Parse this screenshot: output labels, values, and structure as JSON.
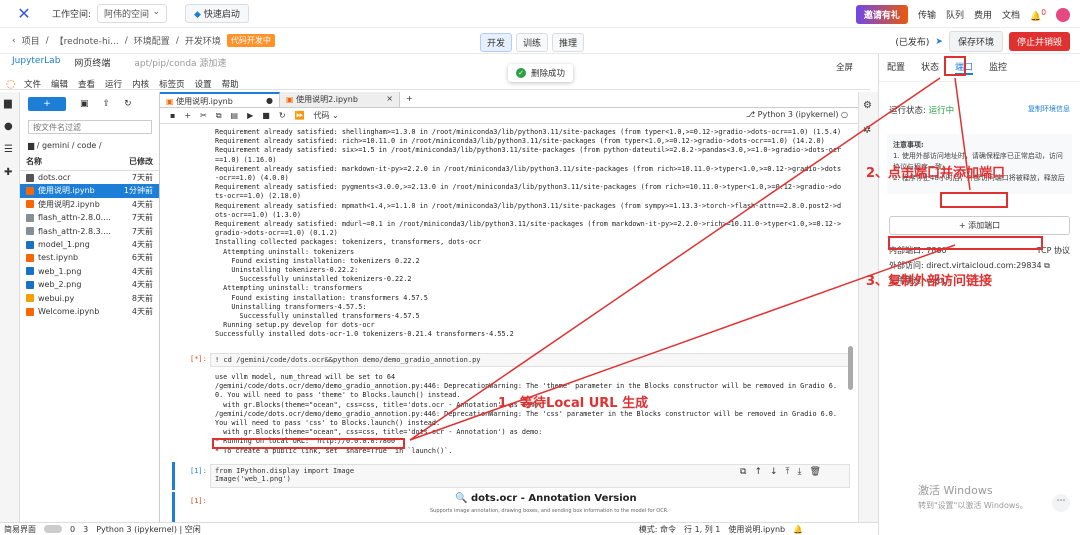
{
  "topbar": {
    "workspace_label": "工作空间:",
    "workspace_value": "阿伟的空间",
    "quick_start": "快速启动",
    "invite": "邀请有礼",
    "links": [
      "传输",
      "队列",
      "费用",
      "文档"
    ],
    "notify_count": "0"
  },
  "secbar": {
    "crumbs": [
      "项目",
      "【rednote-hi...",
      "环境配置",
      "开发环境"
    ],
    "env_tag": "代码开发中",
    "modes": [
      "开发",
      "训练",
      "推理"
    ],
    "published": "(已发布)",
    "save_env": "保存环境",
    "stop_destroy": "停止并销毁"
  },
  "jupyter": {
    "tabs": [
      "JupyterLab",
      "网页终端"
    ],
    "path_hint": "apt/pip/conda 源加速",
    "fullscreen": "全屏",
    "menus": [
      "文件",
      "编辑",
      "查看",
      "运行",
      "内核",
      "标签页",
      "设置",
      "帮助"
    ],
    "filter_placeholder": "按文件名过滤",
    "cwd": "/ gemini / code /",
    "col_name": "名称",
    "col_modified": "已修改",
    "files": [
      {
        "name": "dots.ocr",
        "mod": "7天前",
        "type": "folder"
      },
      {
        "name": "使用说明.ipynb",
        "mod": "1分钟前",
        "type": "nb",
        "selected": true
      },
      {
        "name": "使用说明2.ipynb",
        "mod": "4天前",
        "type": "nb"
      },
      {
        "name": "flash_attn-2.8.0....",
        "mod": "7天前",
        "type": "file"
      },
      {
        "name": "flash_attn-2.8.3....",
        "mod": "7天前",
        "type": "file"
      },
      {
        "name": "model_1.png",
        "mod": "4天前",
        "type": "img"
      },
      {
        "name": "test.ipynb",
        "mod": "6天前",
        "type": "nb"
      },
      {
        "name": "web_1.png",
        "mod": "4天前",
        "type": "img"
      },
      {
        "name": "web_2.png",
        "mod": "4天前",
        "type": "img"
      },
      {
        "name": "webui.py",
        "mod": "8天前",
        "type": "py"
      },
      {
        "name": "Welcome.ipynb",
        "mod": "4天前",
        "type": "nb"
      }
    ],
    "nb_tabs": [
      "使用说明.ipynb",
      "使用说明2.ipynb"
    ],
    "toolbar_cell_type": "代码",
    "kernel": "Python 3 (ipykernel)",
    "output_lines": [
      "Requirement already satisfied: shellingham>=1.3.0 in /root/miniconda3/lib/python3.11/site-packages (from typer<1.0,>=0.12->gradio->dots-ocr==1.0) (1.5.4)",
      "Requirement already satisfied: rich>=10.11.0 in /root/miniconda3/lib/python3.11/site-packages (from typer<1.0,>=0.12->gradio->dots-ocr==1.0) (14.2.0)",
      "Requirement already satisfied: six>=1.5 in /root/miniconda3/lib/python3.11/site-packages (from python-dateutil>=2.8.2->pandas<3.0,>=1.0->gradio->dots-ocr",
      "==1.0) (1.16.0)",
      "Requirement already satisfied: markdown-it-py>=2.2.0 in /root/miniconda3/lib/python3.11/site-packages (from rich>=10.11.0->typer<1.0,>=0.12->gradio->dots",
      "-ocr==1.0) (4.0.0)",
      "Requirement already satisfied: pygments<3.0.0,>=2.13.0 in /root/miniconda3/lib/python3.11/site-packages (from rich>=10.11.0->typer<1.0,>=0.12->gradio->do",
      "ts-ocr==1.0) (2.18.0)",
      "Requirement already satisfied: mpmath<1.4,>=1.1.0 in /root/miniconda3/lib/python3.11/site-packages (from sympy>=1.13.3->torch->flash-attn==2.8.0.post2->d",
      "ots-ocr==1.0) (1.3.0)",
      "Requirement already satisfied: mdurl~=0.1 in /root/miniconda3/lib/python3.11/site-packages (from markdown-it-py>=2.2.0->rich>=10.11.0->typer<1.0,>=0.12->",
      "gradio->dots-ocr==1.0) (0.1.2)",
      "Installing collected packages: tokenizers, transformers, dots-ocr",
      "  Attempting uninstall: tokenizers",
      "    Found existing installation: tokenizers 0.22.2",
      "    Uninstalling tokenizers-0.22.2:",
      "      Successfully uninstalled tokenizers-0.22.2",
      "  Attempting uninstall: transformers",
      "    Found existing installation: transformers 4.57.5",
      "    Uninstalling transformers-4.57.5:",
      "      Successfully uninstalled transformers-4.57.5",
      "  Running setup.py develop for dots-ocr",
      "Successfully installed dots-ocr-1.0 tokenizers-0.21.4 transformers-4.55.2"
    ],
    "cell2_prompt": "[*]:",
    "cell2_code": "! cd /gemini/code/dots.ocr&&python demo/demo_gradio_annotion.py",
    "cell2_output": [
      "use vllm model, num_thread will be set to 64",
      "/gemini/code/dots.ocr/demo/demo_gradio_annotion.py:446: DeprecationWarning: The 'theme' parameter in the Blocks constructor will be removed in Gradio 6.",
      "0. You will need to pass 'theme' to Blocks.launch() instead.",
      "  with gr.Blocks(theme=\"ocean\", css=css, title='dots.ocr - Annotation') as demo:",
      "/gemini/code/dots.ocr/demo/demo_gradio_annotion.py:446: DeprecationWarning: The 'css' parameter in the Blocks constructor will be removed in Gradio 6.0.",
      "You will need to pass 'css' to Blocks.launch() instead.",
      "  with gr.Blocks(theme=\"ocean\", css=css, title='dots.ocr - Annotation') as demo:",
      "* Running on local URL:  http://0.0.0.0:7860",
      "* To create a public link, set `share=True` in `launch()`."
    ],
    "cell3_prompt": "[1]:",
    "cell3_code1": "from IPython.display import Image",
    "cell3_code2": "Image('web_1.png')",
    "cell4_prompt": "[1]:",
    "img_title": "dots.ocr - Annotation Version",
    "img_sub": "Supports image annotation, drawing boxes, and sending box information to the model for OCR."
  },
  "right_panel": {
    "tabs": [
      "配置",
      "状态",
      "端口",
      "监控"
    ],
    "run_state_label": "运行状态:",
    "run_state": "运行中",
    "copy_env": "复制环境信息",
    "notice_title": "注意事项:",
    "notice_1": "1. 使用外部访问地址时，请确保程序已正常启动，访问协议与程序一致。",
    "notice_2": "2. 程序停止48小时后，外部访问端口将被释放，释放后",
    "add_port": "添加端口",
    "inner_port": "内部端口: 7860",
    "protocol": "TCP 协议",
    "external": "外部访问: direct.virtaicloud.com:29834",
    "usage": "使用用途: webui"
  },
  "statusbar": {
    "simple": "简易界面",
    "kernel": "Python 3 (ipykernel) | 空闲",
    "mode": "模式: 命令",
    "pos": "行 1, 列 1",
    "file": "使用说明.ipynb",
    "count_a": "0",
    "count_b": "3"
  },
  "toast": "删除成功",
  "annotations": {
    "a1": "1、等待Local URL 生成",
    "a2": "2、点击端口并添加端口",
    "a3": "3、复制外部访问链接"
  },
  "watermark": {
    "line1": "激活 Windows",
    "line2": "转到\"设置\"以激活 Windows。"
  },
  "colors": {
    "accent": "#1c7ed6",
    "annotation": "#e03131",
    "stop": "#e03131"
  }
}
